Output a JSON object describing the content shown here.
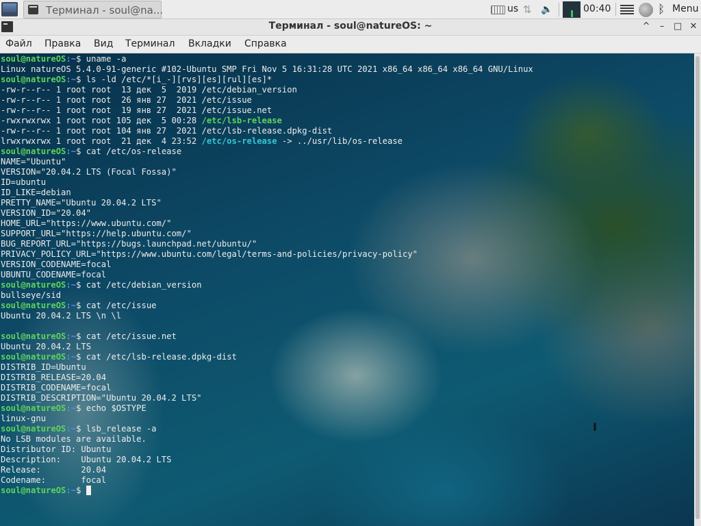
{
  "panel": {
    "task_title": "Терминал - soul@na...",
    "keyboard_layout": "us",
    "clock": "00:40",
    "menu_label": "Menu"
  },
  "window": {
    "title": "Терминал - soul@natureOS: ~",
    "controls": [
      "^",
      "–",
      "□",
      "✕"
    ]
  },
  "menubar": [
    "Файл",
    "Правка",
    "Вид",
    "Терминал",
    "Вкладки",
    "Справка"
  ],
  "terminal": {
    "prompt_user": "soul@natureOS",
    "prompt_path": ":~",
    "prompt_symbol": "$ ",
    "lines": [
      {
        "type": "cmd",
        "text": "uname -a"
      },
      {
        "type": "out",
        "text": "Linux natureOS 5.4.0-91-generic #102-Ubuntu SMP Fri Nov 5 16:31:28 UTC 2021 x86_64 x86_64 x86_64 GNU/Linux"
      },
      {
        "type": "cmd",
        "text": "ls -ld /etc/*[i_-][rvs][es][rul][es]*"
      },
      {
        "type": "out",
        "text": "-rw-r--r-- 1 root root  13 дек  5  2019 /etc/debian_version"
      },
      {
        "type": "out",
        "text": "-rw-r--r-- 1 root root  26 янв 27  2021 /etc/issue"
      },
      {
        "type": "out",
        "text": "-rw-r--r-- 1 root root  19 янв 27  2021 /etc/issue.net"
      },
      {
        "type": "ls",
        "prefix": "-rwxrwxrwx 1 root root 105 дек  5 00:28 ",
        "name": "/etc/lsb-release",
        "cls": "ls-exec",
        "suffix": ""
      },
      {
        "type": "out",
        "text": "-rw-r--r-- 1 root root 104 янв 27  2021 /etc/lsb-release.dpkg-dist"
      },
      {
        "type": "ls",
        "prefix": "lrwxrwxrwx 1 root root  21 дек  4 23:52 ",
        "name": "/etc/os-release",
        "cls": "ls-link",
        "suffix": " -> ../usr/lib/os-release"
      },
      {
        "type": "cmd",
        "text": "cat /etc/os-release"
      },
      {
        "type": "out",
        "text": "NAME=\"Ubuntu\""
      },
      {
        "type": "out",
        "text": "VERSION=\"20.04.2 LTS (Focal Fossa)\""
      },
      {
        "type": "out",
        "text": "ID=ubuntu"
      },
      {
        "type": "out",
        "text": "ID_LIKE=debian"
      },
      {
        "type": "out",
        "text": "PRETTY_NAME=\"Ubuntu 20.04.2 LTS\""
      },
      {
        "type": "out",
        "text": "VERSION_ID=\"20.04\""
      },
      {
        "type": "out",
        "text": "HOME_URL=\"https://www.ubuntu.com/\""
      },
      {
        "type": "out",
        "text": "SUPPORT_URL=\"https://help.ubuntu.com/\""
      },
      {
        "type": "out",
        "text": "BUG_REPORT_URL=\"https://bugs.launchpad.net/ubuntu/\""
      },
      {
        "type": "out",
        "text": "PRIVACY_POLICY_URL=\"https://www.ubuntu.com/legal/terms-and-policies/privacy-policy\""
      },
      {
        "type": "out",
        "text": "VERSION_CODENAME=focal"
      },
      {
        "type": "out",
        "text": "UBUNTU_CODENAME=focal"
      },
      {
        "type": "cmd",
        "text": "cat /etc/debian_version"
      },
      {
        "type": "out",
        "text": "bullseye/sid"
      },
      {
        "type": "cmd",
        "text": "cat /etc/issue"
      },
      {
        "type": "out",
        "text": "Ubuntu 20.04.2 LTS \\n \\l"
      },
      {
        "type": "out",
        "text": ""
      },
      {
        "type": "cmd",
        "text": "cat /etc/issue.net"
      },
      {
        "type": "out",
        "text": "Ubuntu 20.04.2 LTS"
      },
      {
        "type": "cmd",
        "text": "cat /etc/lsb-release.dpkg-dist"
      },
      {
        "type": "out",
        "text": "DISTRIB_ID=Ubuntu"
      },
      {
        "type": "out",
        "text": "DISTRIB_RELEASE=20.04"
      },
      {
        "type": "out",
        "text": "DISTRIB_CODENAME=focal"
      },
      {
        "type": "out",
        "text": "DISTRIB_DESCRIPTION=\"Ubuntu 20.04.2 LTS\""
      },
      {
        "type": "cmd",
        "text": "echo $OSTYPE"
      },
      {
        "type": "out",
        "text": "linux-gnu"
      },
      {
        "type": "cmd",
        "text": "lsb_release -a"
      },
      {
        "type": "out",
        "text": "No LSB modules are available."
      },
      {
        "type": "out",
        "text": "Distributor ID: Ubuntu"
      },
      {
        "type": "out",
        "text": "Description:    Ubuntu 20.04.2 LTS"
      },
      {
        "type": "out",
        "text": "Release:        20.04"
      },
      {
        "type": "out",
        "text": "Codename:       focal"
      },
      {
        "type": "cmd",
        "text": "",
        "cursor": true
      }
    ]
  }
}
